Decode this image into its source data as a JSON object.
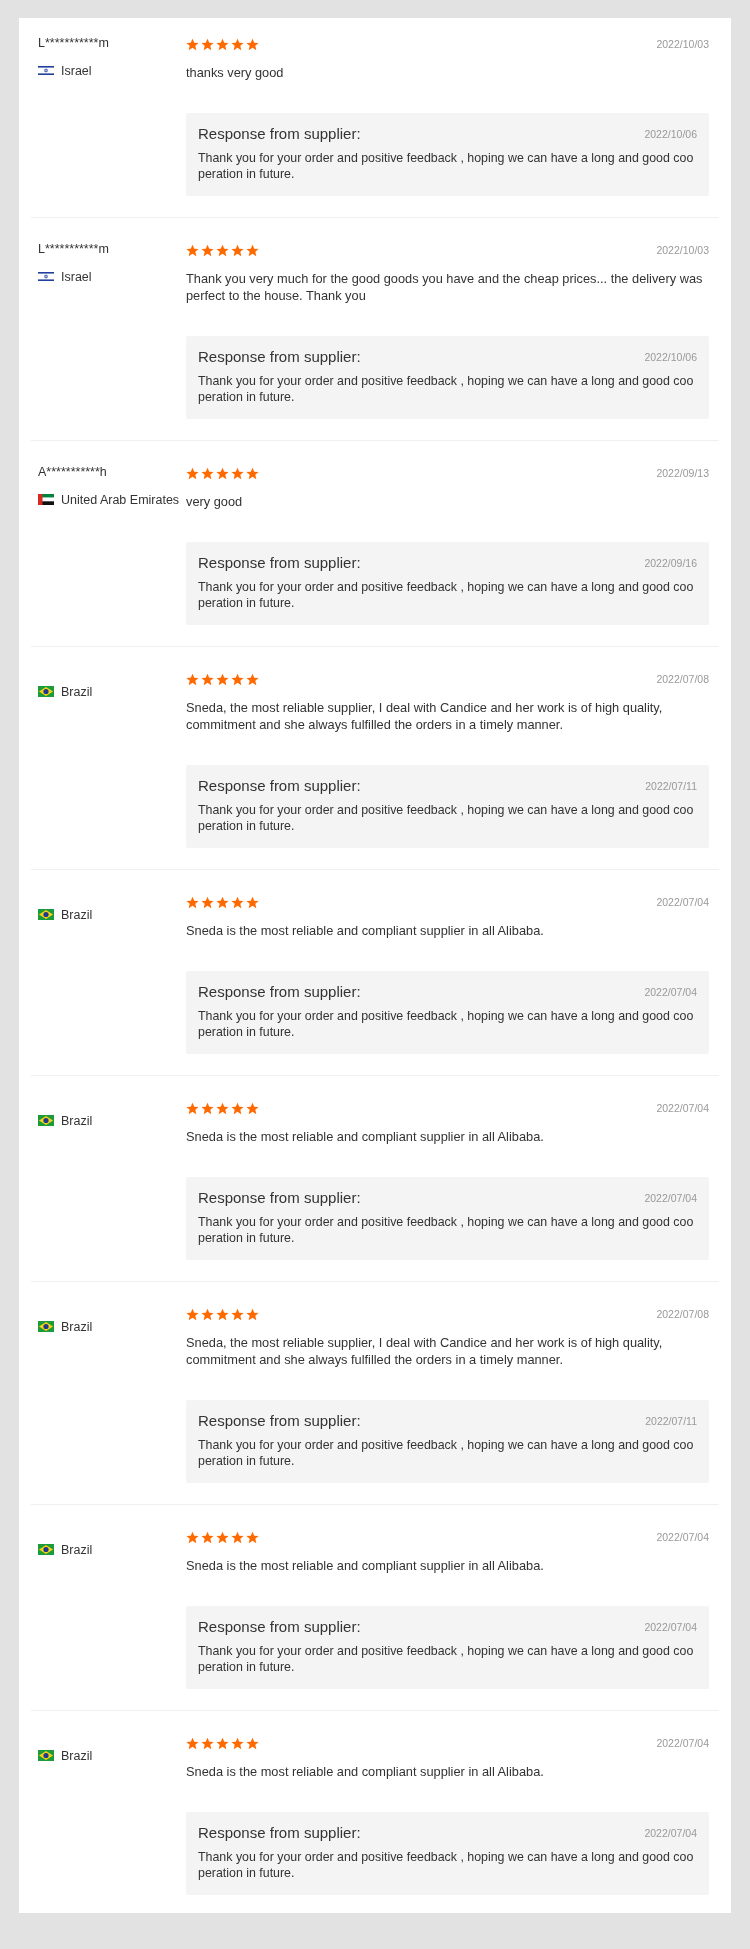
{
  "reviews": [
    {
      "reviewer": "L***********m",
      "country": "Israel",
      "kind": "il",
      "stars": 5,
      "date": "2022/10/03",
      "comment": "thanks very good",
      "response": {
        "title": "Response from supplier:",
        "date": "2022/10/06",
        "text": "Thank you for your order and positive feedback , hoping we can have a long and good cooperation in future."
      }
    },
    {
      "reviewer": "L***********m",
      "country": "Israel",
      "kind": "il",
      "stars": 5,
      "date": "2022/10/03",
      "comment": "Thank you very much for the good goods you have and the cheap prices... the delivery was perfect to the house. Thank you",
      "response": {
        "title": "Response from supplier:",
        "date": "2022/10/06",
        "text": "Thank you for your order and positive feedback , hoping we can have a long and good cooperation in future."
      }
    },
    {
      "reviewer": "A***********h",
      "country": "United Arab Emirates",
      "kind": "ae",
      "stars": 5,
      "date": "2022/09/13",
      "comment": "very good",
      "response": {
        "title": "Response from supplier:",
        "date": "2022/09/16",
        "text": "Thank you for your order and positive feedback , hoping we can have a long and good cooperation in future."
      }
    },
    {
      "country": "Brazil",
      "kind": "br",
      "stars": 5,
      "date": "2022/07/08",
      "comment": "Sneda, the most reliable supplier, I deal with Candice and her work is of high quality, commitment and she always fulfilled the orders in a timely manner.",
      "response": {
        "title": "Response from supplier:",
        "date": "2022/07/11",
        "text": "Thank you for your order and positive feedback , hoping we can have a long and good cooperation in future."
      }
    },
    {
      "country": "Brazil",
      "kind": "br",
      "stars": 5,
      "date": "2022/07/04",
      "comment": "Sneda is the most reliable and compliant supplier in all Alibaba.",
      "response": {
        "title": "Response from supplier:",
        "date": "2022/07/04",
        "text": "Thank you for your order and positive feedback , hoping we can have a long and good cooperation in future."
      }
    },
    {
      "country": "Brazil",
      "kind": "br",
      "stars": 5,
      "date": "2022/07/04",
      "comment": "Sneda is the most reliable and compliant supplier in all Alibaba.",
      "response": {
        "title": "Response from supplier:",
        "date": "2022/07/04",
        "text": "Thank you for your order and positive feedback , hoping we can have a long and good cooperation in future."
      }
    },
    {
      "country": "Brazil",
      "kind": "br",
      "stars": 5,
      "date": "2022/07/08",
      "comment": "Sneda, the most reliable supplier, I deal with Candice and her work is of high quality, commitment and she always fulfilled the orders in a timely manner.",
      "response": {
        "title": "Response from supplier:",
        "date": "2022/07/11",
        "text": "Thank you for your order and positive feedback , hoping we can have a long and good cooperation in future."
      }
    },
    {
      "country": "Brazil",
      "kind": "br",
      "stars": 5,
      "date": "2022/07/04",
      "comment": "Sneda is the most reliable and compliant supplier in all Alibaba.",
      "response": {
        "title": "Response from supplier:",
        "date": "2022/07/04",
        "text": "Thank you for your order and positive feedback , hoping we can have a long and good cooperation in future."
      }
    },
    {
      "country": "Brazil",
      "kind": "br",
      "stars": 5,
      "date": "2022/07/04",
      "comment": "Sneda is the most reliable and compliant supplier in all Alibaba.",
      "response": {
        "title": "Response from supplier:",
        "date": "2022/07/04",
        "text": "Thank you for your order and positive feedback , hoping we can have a long and good cooperation in future."
      }
    }
  ]
}
